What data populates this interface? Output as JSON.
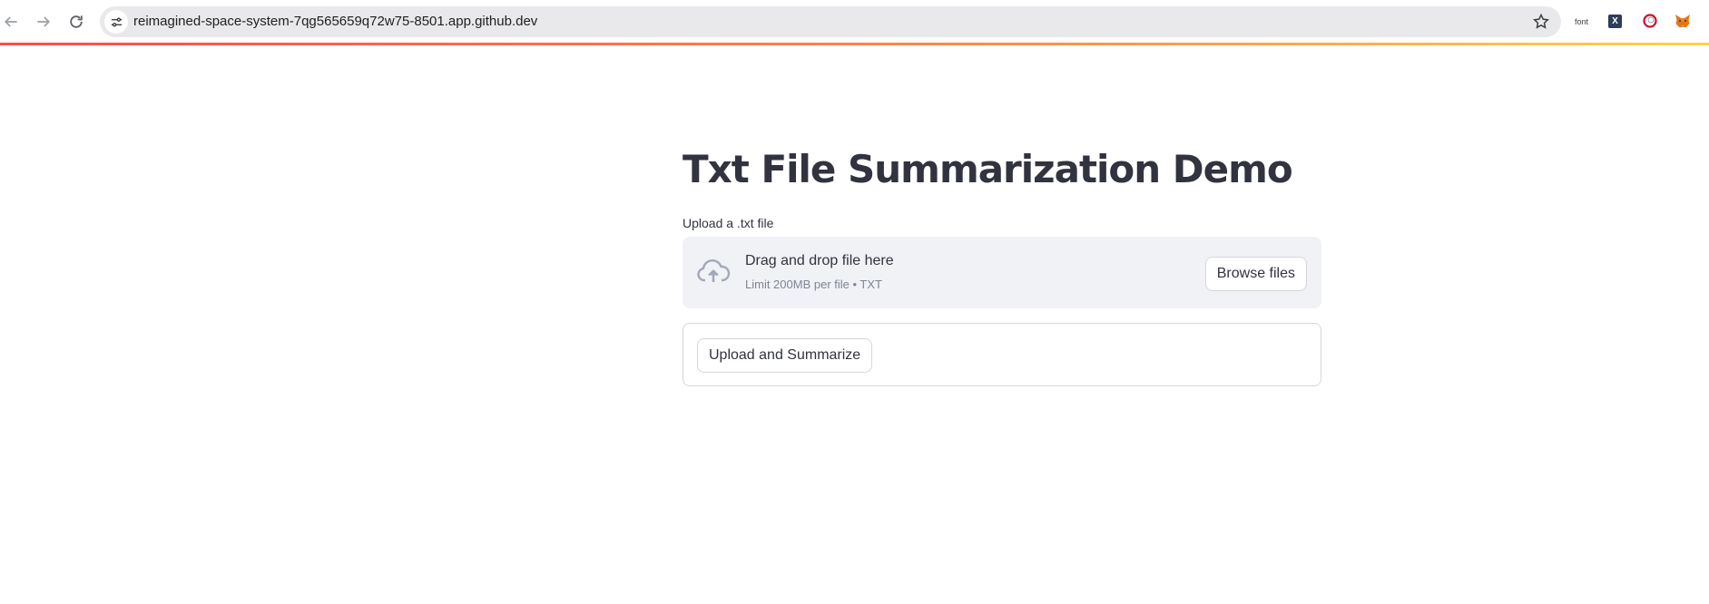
{
  "browser": {
    "url": "reimagined-space-system-7qg565659q72w75-8501.app.github.dev",
    "extensions": {
      "font_label": "font",
      "x_label": "X"
    },
    "accent_gradient": [
      "#ff4b4b",
      "#ff8c4b",
      "#ffd24b"
    ]
  },
  "page": {
    "title": "Txt File Summarization Demo",
    "uploader": {
      "label": "Upload a .txt file",
      "drop_title": "Drag and drop file here",
      "drop_subtitle": "Limit 200MB per file • TXT",
      "browse_label": "Browse files",
      "icon": "cloud-upload-icon"
    },
    "form": {
      "submit_label": "Upload and Summarize"
    }
  },
  "colors": {
    "text": "#31333f",
    "dropzone_bg": "#f0f2f6",
    "muted_text": "#808495",
    "border": "#d6d6d9"
  }
}
